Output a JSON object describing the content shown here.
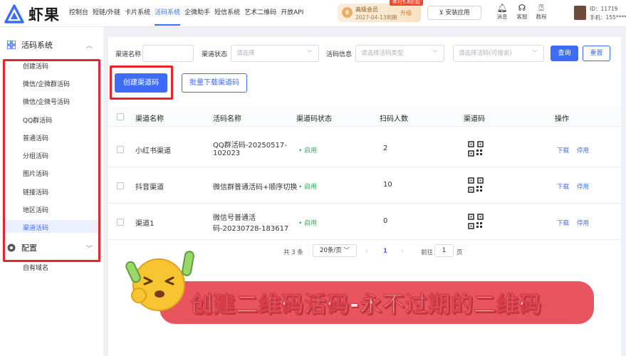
{
  "app": {
    "logo_text": "虾果"
  },
  "topnav": {
    "items": [
      "控制台",
      "短链/外链",
      "卡片系统",
      "活码系统",
      "企微助手",
      "短信系统",
      "艺术二维码",
      "开放API"
    ],
    "active_index": 3
  },
  "vip": {
    "level": "高级会员",
    "expire": "2027-04-13到期",
    "upgrade": "升级",
    "promo": "年付5.8折起"
  },
  "install": {
    "label": "安装应用"
  },
  "top_icons": [
    {
      "icon": "bell-icon",
      "label": "消息"
    },
    {
      "icon": "headset-icon",
      "label": "客服"
    },
    {
      "icon": "help-icon",
      "label": "教程"
    }
  ],
  "user": {
    "id": "ID：11719",
    "phone": "手机：155*****"
  },
  "sidebar": {
    "group1": {
      "title": "活码系统",
      "icon": "grid-icon"
    },
    "items": [
      "创建活码",
      "微信/企微群活码",
      "微信/企微号活码",
      "QQ群活码",
      "普通活码",
      "分组活码",
      "图片活码",
      "链接活码",
      "地区活码",
      "渠道活码"
    ],
    "active_index": 9,
    "group2": {
      "title": "配置",
      "icon": "config-icon"
    },
    "group2_items": [
      "自有域名"
    ]
  },
  "filters": {
    "channel_name_label": "渠道名称",
    "channel_name_value": "",
    "channel_status_label": "渠道状态",
    "channel_status_placeholder": "请选择",
    "code_info_label": "活码信息",
    "code_type_placeholder": "请选择活码类型",
    "code_select_placeholder": "请选择活码(可搜索)",
    "query_label": "查询",
    "reset_label": "重置"
  },
  "actions": {
    "create_label": "创建渠道码",
    "batch_download_label": "批量下载渠道码"
  },
  "table": {
    "headers": [
      "渠道名称",
      "活码名称",
      "渠道码状态",
      "扫码人数",
      "渠道码",
      "操作"
    ],
    "rows": [
      {
        "channel": "小红书渠道",
        "code_line1": "QQ群活码-20250517-",
        "code_line2": "102023",
        "status": "启用",
        "scans": "2",
        "download": "下载",
        "disable": "停用"
      },
      {
        "channel": "抖音渠道",
        "code_line1": "微信群普通活码+顺序切换",
        "code_line2": "",
        "status": "启用",
        "scans": "10",
        "download": "下载",
        "disable": "停用"
      },
      {
        "channel": "渠道1",
        "code_line1": "微信号普通活",
        "code_line2": "码-20230728-183617",
        "status": "启用",
        "scans": "0",
        "download": "下载",
        "disable": "停用"
      }
    ]
  },
  "pagination": {
    "total": "共 3 条",
    "page_size": "20条/页",
    "current": "1",
    "goto_label": "前往",
    "goto_value": "1",
    "page_suffix": "页"
  },
  "overlay": {
    "caption": "创建二维码活码-永不过期的二维码"
  },
  "colors": {
    "primary": "#3d6cf6",
    "highlight_red": "#e8232c",
    "banner": "#e8555f",
    "status_green": "#2bb05a"
  }
}
